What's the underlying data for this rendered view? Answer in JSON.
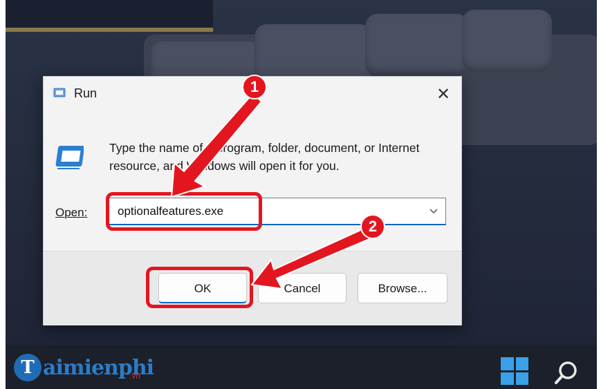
{
  "dialog": {
    "title": "Run",
    "close_glyph": "✕",
    "description": "Type the name of a program, folder, document, or Internet resource, and Windows will open it for you.",
    "open_label": "Open:",
    "open_value": "optionalfeatures.exe",
    "ok_label": "OK",
    "cancel_label": "Cancel",
    "browse_label": "Browse..."
  },
  "annotations": {
    "step1": "1",
    "step2": "2",
    "color": "#e3161f"
  },
  "watermark": {
    "brand_initial": "T",
    "brand_rest": "aimienphi",
    "brand_suffix": ".vn"
  },
  "taskbar": {
    "icons": [
      "windows-start-icon",
      "search-icon"
    ],
    "accent": "#3aa0e8"
  }
}
